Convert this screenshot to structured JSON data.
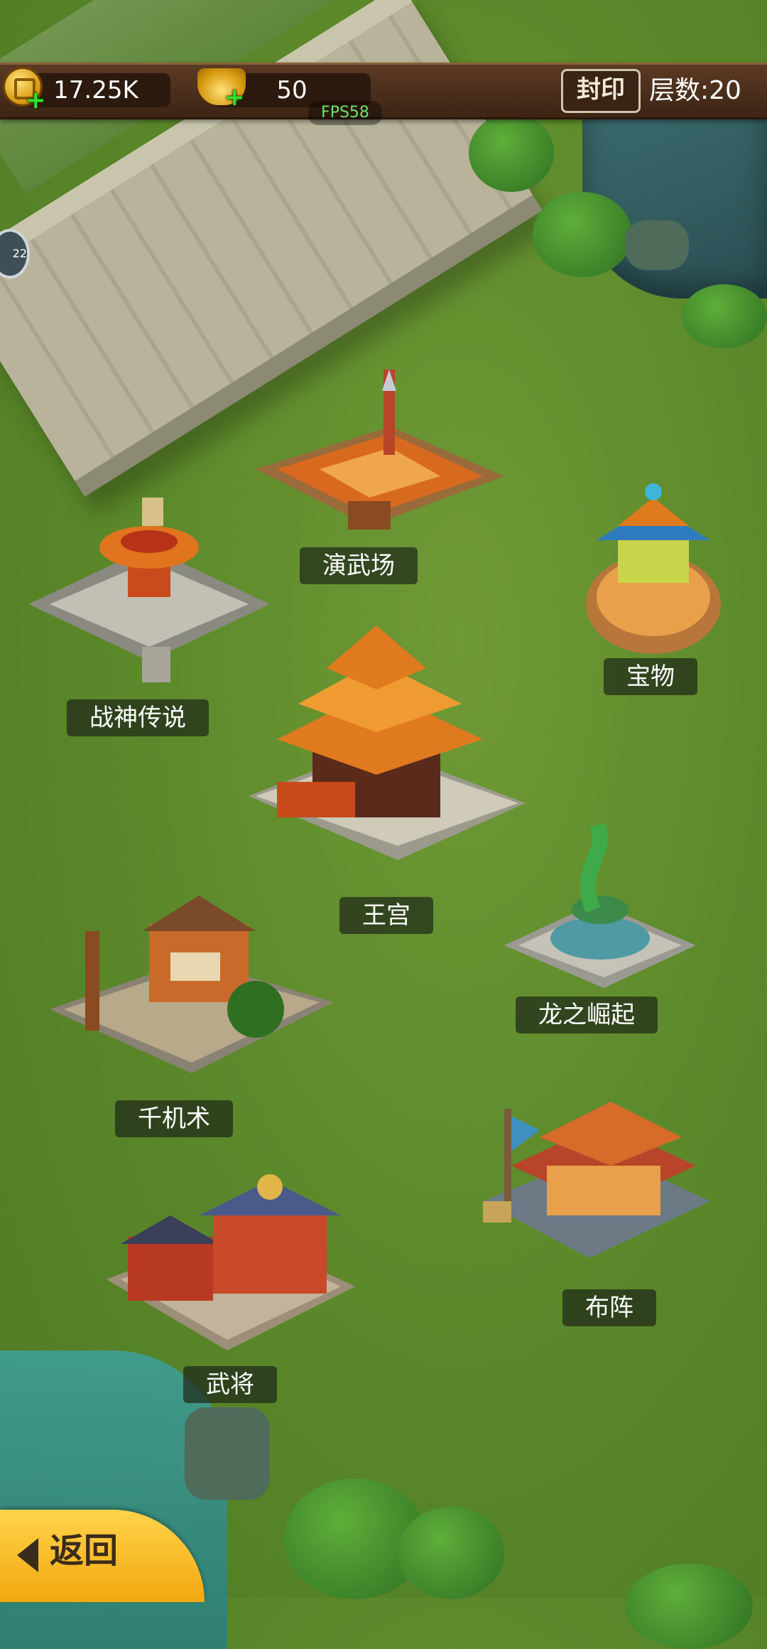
{
  "top_bar": {
    "coins": "17.25K",
    "ingots": "50",
    "seal_label": "封印",
    "layers_label": "层数:20",
    "fps": "FPS58"
  },
  "buildings": {
    "yanwuchang": "演武场",
    "zhanshen": "战神传说",
    "baowu": "宝物",
    "wanggong": "王宫",
    "longzhi": "龙之崛起",
    "qianji": "千机术",
    "buzhen": "布阵",
    "wujiang": "武将"
  },
  "back_label": "返回",
  "side_badge": "22",
  "colors": {
    "grass": "#5d8a2b",
    "bar": "#4a2e1b",
    "accent": "#f2a80f"
  }
}
